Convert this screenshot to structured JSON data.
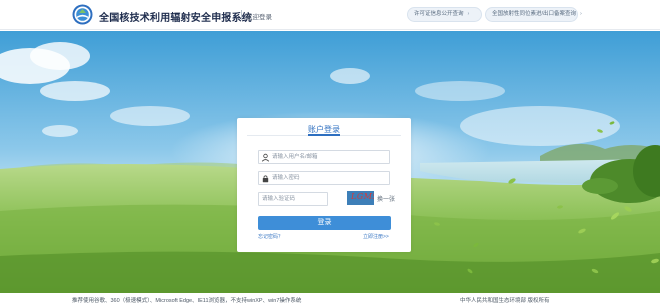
{
  "header": {
    "title": "全国核技术利用辐射安全申报系统",
    "welcome": "欢迎登录",
    "links": [
      {
        "label": "许可证信息公开查询"
      },
      {
        "label": "全国放射性同位素进/出口备案查询"
      }
    ]
  },
  "login": {
    "title": "账户登录",
    "username_placeholder": "请输入用户名/邮箱",
    "password_placeholder": "请输入密码",
    "captcha_placeholder": "请输入验证码",
    "captcha_text": "LGM5",
    "refresh_label": "换一张",
    "submit_label": "登录",
    "forgot_label": "忘记密码？",
    "register_label": "立即注册>>"
  },
  "footer": {
    "browser_note": "推荐使用谷歌、360（极速模式）、Microsoft Edge、IE11浏览器，不支持winXP、win7操作系统",
    "copyright": "中华人民共和国生态环境部 版权所有"
  },
  "colors": {
    "accent": "#3e8ed8",
    "title_text": "#1d2b4c",
    "link_text": "#3d79c4"
  }
}
